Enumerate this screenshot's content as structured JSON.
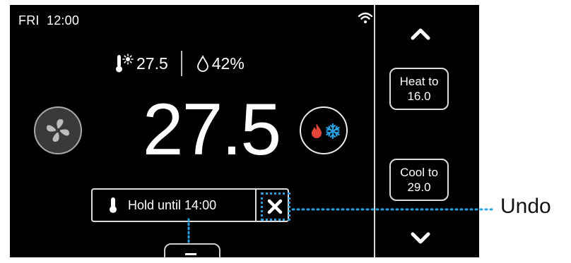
{
  "status_bar": {
    "day": "FRI",
    "time": "12:00"
  },
  "readings": {
    "indoor_temp": "27.5",
    "humidity": "42%"
  },
  "main": {
    "current_temp": "27.5"
  },
  "hold": {
    "label": "Hold until 14:00"
  },
  "setpoints": {
    "heat": {
      "label": "Heat to",
      "value": "16.0"
    },
    "cool": {
      "label": "Cool to",
      "value": "29.0"
    }
  },
  "callout": {
    "label": "Undo"
  },
  "colors": {
    "accent_callout": "#2aa0e0",
    "heat_flame": "#e2453a",
    "cool_snow": "#2aa0e0"
  },
  "icons": [
    "wifi-icon",
    "thermometer-sun-icon",
    "humidity-drop-icon",
    "fan-icon",
    "flame-icon",
    "snowflake-icon",
    "thermometer-icon",
    "close-icon",
    "menu-icon",
    "chevron-up-icon",
    "chevron-down-icon"
  ]
}
